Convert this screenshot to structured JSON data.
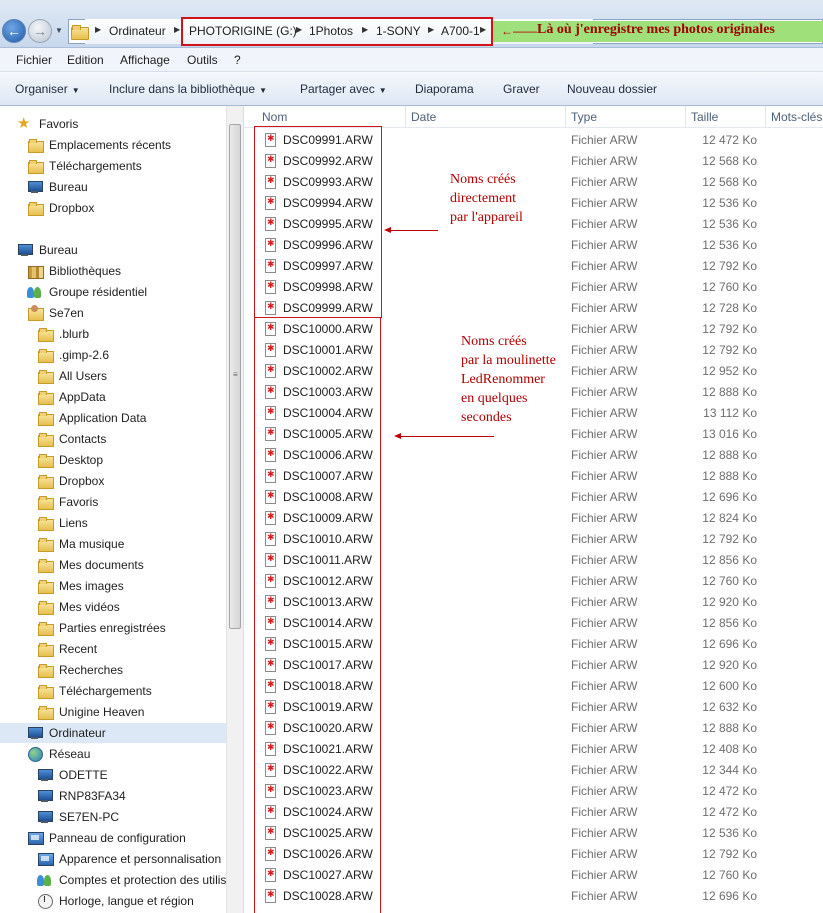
{
  "address_bar": {
    "breadcrumbs": [
      "Ordinateur",
      "PHOTORIGINE (G:)",
      "1Photos",
      "1-SONY",
      "A700-1"
    ],
    "annotation_arrow": "←——",
    "annotation": "Là où j'enregistre mes photos originales"
  },
  "menubar": [
    "Fichier",
    "Edition",
    "Affichage",
    "Outils",
    "?"
  ],
  "toolbar": {
    "organise": "Organiser",
    "include": "Inclure dans la bibliothèque",
    "share": "Partager avec",
    "slideshow": "Diaporama",
    "burn": "Graver",
    "new_folder": "Nouveau dossier"
  },
  "sidebar": {
    "items": [
      {
        "label": "Favoris",
        "icon": "star-icon",
        "level": 0
      },
      {
        "label": "Emplacements récents",
        "icon": "folder-icon",
        "level": 1
      },
      {
        "label": "Téléchargements",
        "icon": "folder-icon",
        "level": 1
      },
      {
        "label": "Bureau",
        "icon": "monitor-icon",
        "level": 1
      },
      {
        "label": "Dropbox",
        "icon": "folder-icon",
        "level": 1
      },
      {
        "label": "",
        "icon": "",
        "level": -1
      },
      {
        "label": "Bureau",
        "icon": "monitor-icon",
        "level": 0
      },
      {
        "label": "Bibliothèques",
        "icon": "library-icon",
        "level": 1
      },
      {
        "label": "Groupe résidentiel",
        "icon": "group-icon",
        "level": 1
      },
      {
        "label": "Se7en",
        "icon": "user-folder-icon",
        "level": 1
      },
      {
        "label": ".blurb",
        "icon": "folder-icon",
        "level": 2
      },
      {
        "label": ".gimp-2.6",
        "icon": "folder-icon",
        "level": 2
      },
      {
        "label": "All Users",
        "icon": "folder-icon",
        "level": 2
      },
      {
        "label": "AppData",
        "icon": "folder-icon",
        "level": 2
      },
      {
        "label": "Application Data",
        "icon": "folder-icon",
        "level": 2
      },
      {
        "label": "Contacts",
        "icon": "folder-icon",
        "level": 2
      },
      {
        "label": "Desktop",
        "icon": "folder-icon",
        "level": 2
      },
      {
        "label": "Dropbox",
        "icon": "folder-icon",
        "level": 2
      },
      {
        "label": "Favoris",
        "icon": "folder-icon",
        "level": 2
      },
      {
        "label": "Liens",
        "icon": "folder-icon",
        "level": 2
      },
      {
        "label": "Ma musique",
        "icon": "folder-icon",
        "level": 2
      },
      {
        "label": "Mes documents",
        "icon": "folder-icon",
        "level": 2
      },
      {
        "label": "Mes images",
        "icon": "folder-icon",
        "level": 2
      },
      {
        "label": "Mes vidéos",
        "icon": "folder-icon",
        "level": 2
      },
      {
        "label": "Parties enregistrées",
        "icon": "folder-icon",
        "level": 2
      },
      {
        "label": "Recent",
        "icon": "folder-icon",
        "level": 2
      },
      {
        "label": "Recherches",
        "icon": "folder-icon",
        "level": 2
      },
      {
        "label": "Téléchargements",
        "icon": "folder-icon",
        "level": 2
      },
      {
        "label": "Unigine Heaven",
        "icon": "folder-icon",
        "level": 2
      },
      {
        "label": "Ordinateur",
        "icon": "monitor-icon",
        "level": 1,
        "selected": true
      },
      {
        "label": "Réseau",
        "icon": "globe-icon",
        "level": 1
      },
      {
        "label": "ODETTE",
        "icon": "monitor-icon",
        "level": 2
      },
      {
        "label": "RNP83FA34",
        "icon": "monitor-icon",
        "level": 2
      },
      {
        "label": "SE7EN-PC",
        "icon": "monitor-icon",
        "level": 2
      },
      {
        "label": "Panneau de configuration",
        "icon": "control-panel-icon",
        "level": 1
      },
      {
        "label": "Apparence et personnalisation",
        "icon": "control-panel-icon",
        "level": 2
      },
      {
        "label": "Comptes et protection des utilis",
        "icon": "group-icon",
        "level": 2
      },
      {
        "label": "Horloge, langue et région",
        "icon": "clock-icon",
        "level": 2
      }
    ]
  },
  "columns": [
    "Nom",
    "Date",
    "Type",
    "Taille",
    "Mots-clés"
  ],
  "files": [
    {
      "name": "DSC09991.ARW",
      "type": "Fichier ARW",
      "size": "12 472 Ko"
    },
    {
      "name": "DSC09992.ARW",
      "type": "Fichier ARW",
      "size": "12 568 Ko"
    },
    {
      "name": "DSC09993.ARW",
      "type": "Fichier ARW",
      "size": "12 568 Ko"
    },
    {
      "name": "DSC09994.ARW",
      "type": "Fichier ARW",
      "size": "12 536 Ko"
    },
    {
      "name": "DSC09995.ARW",
      "type": "Fichier ARW",
      "size": "12 536 Ko"
    },
    {
      "name": "DSC09996.ARW",
      "type": "Fichier ARW",
      "size": "12 536 Ko"
    },
    {
      "name": "DSC09997.ARW",
      "type": "Fichier ARW",
      "size": "12 792 Ko"
    },
    {
      "name": "DSC09998.ARW",
      "type": "Fichier ARW",
      "size": "12 760 Ko"
    },
    {
      "name": "DSC09999.ARW",
      "type": "Fichier ARW",
      "size": "12 728 Ko"
    },
    {
      "name": "DSC10000.ARW",
      "type": "Fichier ARW",
      "size": "12 792 Ko"
    },
    {
      "name": "DSC10001.ARW",
      "type": "Fichier ARW",
      "size": "12 792 Ko"
    },
    {
      "name": "DSC10002.ARW",
      "type": "Fichier ARW",
      "size": "12 952 Ko"
    },
    {
      "name": "DSC10003.ARW",
      "type": "Fichier ARW",
      "size": "12 888 Ko"
    },
    {
      "name": "DSC10004.ARW",
      "type": "Fichier ARW",
      "size": "13 112 Ko"
    },
    {
      "name": "DSC10005.ARW",
      "type": "Fichier ARW",
      "size": "13 016 Ko"
    },
    {
      "name": "DSC10006.ARW",
      "type": "Fichier ARW",
      "size": "12 888 Ko"
    },
    {
      "name": "DSC10007.ARW",
      "type": "Fichier ARW",
      "size": "12 888 Ko"
    },
    {
      "name": "DSC10008.ARW",
      "type": "Fichier ARW",
      "size": "12 696 Ko"
    },
    {
      "name": "DSC10009.ARW",
      "type": "Fichier ARW",
      "size": "12 824 Ko"
    },
    {
      "name": "DSC10010.ARW",
      "type": "Fichier ARW",
      "size": "12 792 Ko"
    },
    {
      "name": "DSC10011.ARW",
      "type": "Fichier ARW",
      "size": "12 856 Ko"
    },
    {
      "name": "DSC10012.ARW",
      "type": "Fichier ARW",
      "size": "12 760 Ko"
    },
    {
      "name": "DSC10013.ARW",
      "type": "Fichier ARW",
      "size": "12 920 Ko"
    },
    {
      "name": "DSC10014.ARW",
      "type": "Fichier ARW",
      "size": "12 856 Ko"
    },
    {
      "name": "DSC10015.ARW",
      "type": "Fichier ARW",
      "size": "12 696 Ko"
    },
    {
      "name": "DSC10017.ARW",
      "type": "Fichier ARW",
      "size": "12 920 Ko"
    },
    {
      "name": "DSC10018.ARW",
      "type": "Fichier ARW",
      "size": "12 600 Ko"
    },
    {
      "name": "DSC10019.ARW",
      "type": "Fichier ARW",
      "size": "12 632 Ko"
    },
    {
      "name": "DSC10020.ARW",
      "type": "Fichier ARW",
      "size": "12 888 Ko"
    },
    {
      "name": "DSC10021.ARW",
      "type": "Fichier ARW",
      "size": "12 408 Ko"
    },
    {
      "name": "DSC10022.ARW",
      "type": "Fichier ARW",
      "size": "12 344 Ko"
    },
    {
      "name": "DSC10023.ARW",
      "type": "Fichier ARW",
      "size": "12 472 Ko"
    },
    {
      "name": "DSC10024.ARW",
      "type": "Fichier ARW",
      "size": "12 472 Ko"
    },
    {
      "name": "DSC10025.ARW",
      "type": "Fichier ARW",
      "size": "12 536 Ko"
    },
    {
      "name": "DSC10026.ARW",
      "type": "Fichier ARW",
      "size": "12 792 Ko"
    },
    {
      "name": "DSC10027.ARW",
      "type": "Fichier ARW",
      "size": "12 760 Ko"
    },
    {
      "name": "DSC10028.ARW",
      "type": "Fichier ARW",
      "size": "12 696 Ko"
    }
  ],
  "annotations": {
    "camera_names": [
      "Noms créés",
      "directement",
      "par l'appareil"
    ],
    "renamer_names": [
      "Noms créés",
      "par la moulinette",
      "LedRenommer",
      "en quelques",
      "secondes"
    ]
  },
  "colors": {
    "annotation_red": "#d0121b",
    "selection": "#dde8f6",
    "header_text": "#4c607a"
  }
}
